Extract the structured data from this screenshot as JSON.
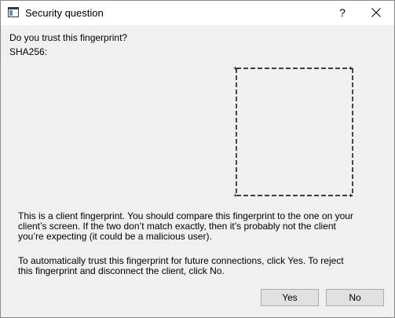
{
  "window": {
    "title": "Security question",
    "help_label": "?",
    "icons": {
      "app": "app-window-icon",
      "close": "close-icon"
    }
  },
  "content": {
    "question": "Do you trust this fingerprint?",
    "sha_label": "SHA256:",
    "fingerprint_visual": "empty-dashed-fingerprint-box",
    "info": "This is a client fingerprint. You should compare this fingerprint to the one on your\nclient’s screen. If the two don’t match exactly, then it’s probably not the client\nyou’re expecting (it could be a malicious user).",
    "instructions": "To automatically trust this fingerprint for future connections, click Yes. To reject\nthis fingerprint and disconnect the client, click No."
  },
  "buttons": {
    "yes": "Yes",
    "no": "No"
  },
  "colors": {
    "dialog_background": "#f0f0f0",
    "titlebar_background": "#ffffff",
    "button_background": "#e1e1e1",
    "button_border": "#adadad"
  }
}
